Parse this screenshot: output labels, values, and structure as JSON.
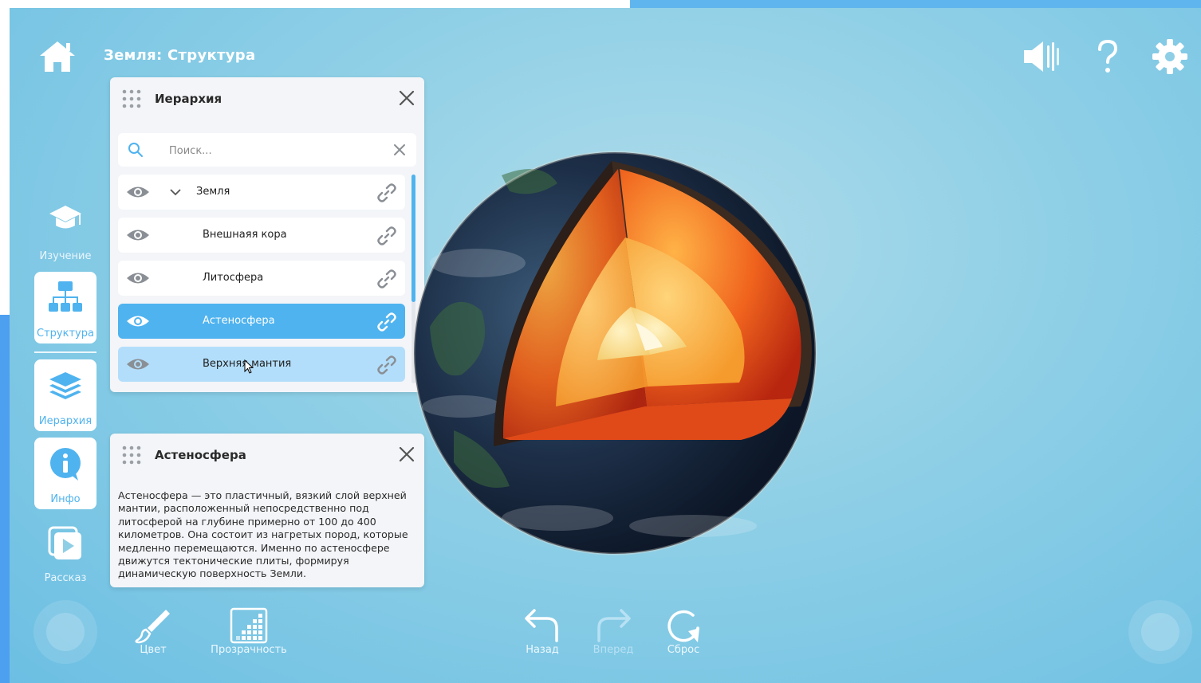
{
  "app": {
    "title": "Земля: Структура"
  },
  "left_nav": {
    "items": [
      {
        "label": "Изучение",
        "icon": "graduation-cap-icon"
      },
      {
        "label": "Структура",
        "icon": "hierarchy-tree-icon",
        "active": true
      },
      {
        "label": "Иерархия",
        "icon": "layers-icon",
        "active": true
      },
      {
        "label": "Инфо",
        "icon": "info-icon",
        "active": true
      },
      {
        "label": "Рассказ",
        "icon": "play-story-icon"
      }
    ]
  },
  "hierarchy_panel": {
    "title": "Иерархия",
    "search_placeholder": "Поиск...",
    "items": [
      {
        "label": "Земля",
        "expanded": true,
        "state": "normal"
      },
      {
        "label": "Внешнаяя кора",
        "state": "normal"
      },
      {
        "label": "Литосфера",
        "state": "normal"
      },
      {
        "label": "Астеносфера",
        "state": "selected"
      },
      {
        "label": "Верхняя мантия",
        "state": "hover"
      }
    ]
  },
  "info_panel": {
    "title": "Астеносфера",
    "text": "Астеносфера — это пластичный, вязкий слой верхней мантии, расположенный непосредственно под литосферой на глубине примерно от 100 до 400 километров. Она состоит из нагретых пород, которые медленно перемещаются. Именно по астеносфере движутся тектонические плиты, формируя динамическую поверхность Земли."
  },
  "toolbar": {
    "color_label": "Цвет",
    "transparency_label": "Прозрачность",
    "back_label": "Назад",
    "forward_label": "Вперед",
    "reset_label": "Сброс"
  },
  "colors": {
    "accent": "#4fb3ef",
    "hover": "#b3defb",
    "background": "#8ecfe6"
  }
}
